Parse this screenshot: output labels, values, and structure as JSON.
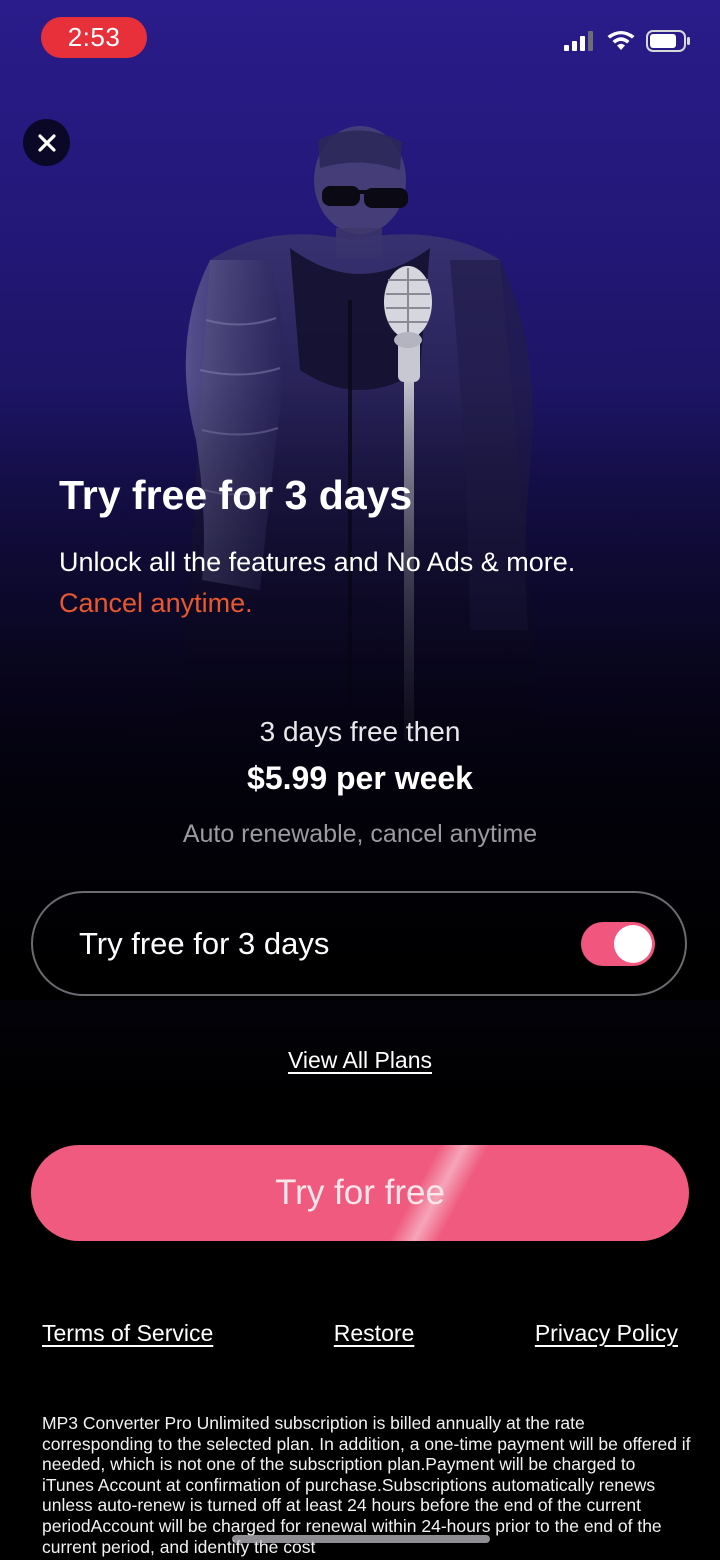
{
  "status_bar": {
    "time": "2:53",
    "icons": [
      "cellular-signal-icon",
      "wifi-icon",
      "battery-icon"
    ]
  },
  "close_button": {
    "icon": "close-icon"
  },
  "hero": {
    "headline": "Try free for 3 days",
    "subline": "Unlock all the features and No Ads & more.",
    "cancel_text": "Cancel anytime."
  },
  "pricing": {
    "trial_line": "3 days free then",
    "price_line": "$5.99 per week",
    "renew_line": "Auto renewable, cancel anytime"
  },
  "trial_toggle": {
    "label": "Try free for 3 days",
    "enabled": true
  },
  "view_plans_label": "View All Plans",
  "cta_label": "Try for free",
  "footer": {
    "terms": "Terms of Service",
    "restore": "Restore",
    "privacy": "Privacy Policy"
  },
  "legal_text": "MP3 Converter Pro Unlimited subscription is billed annually at the rate corresponding to the selected plan. In addition, a one-time payment will be offered if needed, which is not one of the subscription plan.Payment will be charged to iTunes Account at confirmation of purchase.Subscriptions automatically renews unless auto-renew is turned off at least 24 hours before the end of the current periodAccount will be  charged for renewal within 24-hours prior to the end of the current period, and identify the cost",
  "colors": {
    "accent_pink": "#ef5a7e",
    "cancel_orange": "#e8582e",
    "time_pill_red": "#e8303b",
    "background_top": "#2a1c8a"
  }
}
